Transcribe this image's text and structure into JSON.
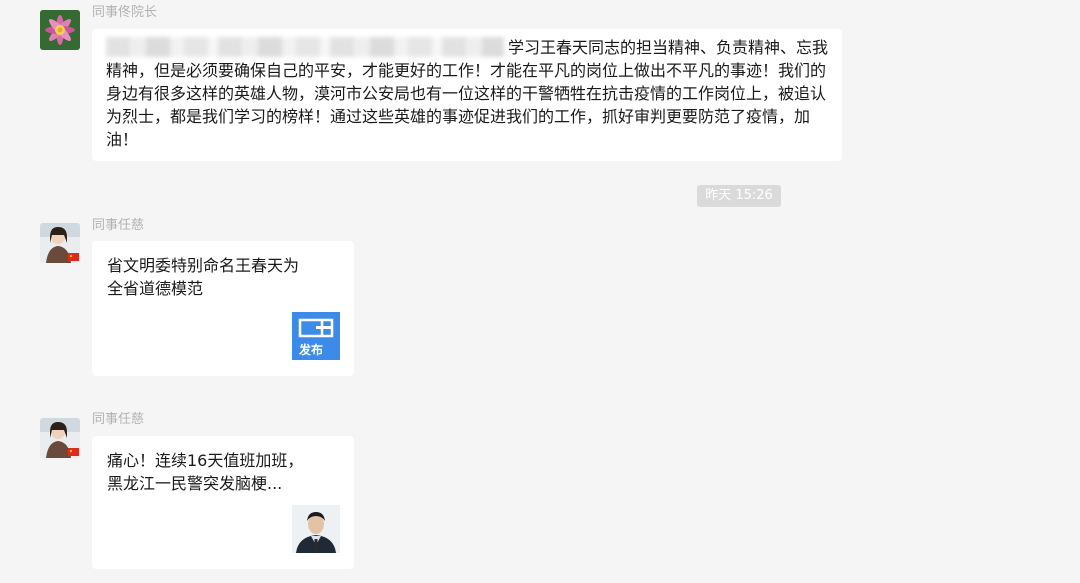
{
  "messages": [
    {
      "sender": "同事佟院长",
      "text": "学习王春天同志的担当精神、负责精神、忘我精神，但是必须要确保自己的平安，才能更好的工作！才能在平凡的岗位上做出不平凡的事迹！我们的身边有很多这样的英雄人物，漠河市公安局也有一位这样的干警牺牲在抗击疫情的工作岗位上，被追认为烈士，都是我们学习的榜样！通过这些英雄的事迹促进我们的工作，抓好审判更要防范了疫情，加油！"
    }
  ],
  "timestamp": "昨天 15:26",
  "cards": [
    {
      "sender": "同事任慈",
      "title": "省文明委特别命名王春天为全省道德模范",
      "thumb_text": "发布"
    },
    {
      "sender": "同事任慈",
      "title": "痛心！连续16天值班加班，黑龙江一民警突发脑梗..."
    }
  ],
  "colors": {
    "background": "#f5f5f5",
    "bubble": "#ffffff",
    "sender_name": "#b2b2b2",
    "time_chip": "#dadada",
    "thumb_blue": "#3d8be8"
  },
  "icons": [
    "lotus-avatar-icon",
    "woman-avatar-icon",
    "flag-badge-icon",
    "media-logo-thumbnail",
    "officer-portrait-thumbnail"
  ]
}
